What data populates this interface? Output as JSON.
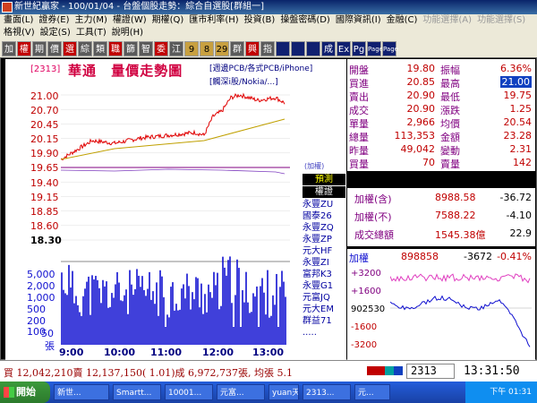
{
  "window": {
    "title": "新世紀贏家 - 100/01/04 - 台盤個股走勢：綜合自選股[群組一]"
  },
  "menu": {
    "row1": [
      "畫面(L)",
      "證券(E)",
      "主力(M)",
      "權證(W)",
      "期權(Q)",
      "匯市利率(H)",
      "投資(B)",
      "操盤密碼(D)",
      "國際資訊(I)",
      "金融(C)",
      "功能選擇(A)",
      "功能選擇(S)"
    ],
    "row2": [
      "格視(V)",
      "設定(S)",
      "工具(T)",
      "說明(H)"
    ]
  },
  "toolbar": {
    "buttons": [
      "加",
      "權",
      "期",
      "價",
      "選",
      "綜",
      "類",
      "職",
      "篩",
      "智",
      "委",
      "江",
      "9",
      "8",
      "29",
      "群",
      "興",
      "指",
      "",
      "",
      "",
      "成",
      "Ex",
      "Pg",
      "Page",
      "Page"
    ]
  },
  "stock": {
    "code": "[2313]",
    "name": "華通",
    "chart_title": "量價走勢圖",
    "concept_line1": "[週邊PCB/各式PCB/iPhone]",
    "concept_line2": "[觸深i股/Nokia/...]"
  },
  "price_axis_labels": [
    "21.00",
    "20.70",
    "20.45",
    "20.15",
    "19.90",
    "19.65",
    "19.40",
    "19.15",
    "18.85",
    "18.60",
    "18.30"
  ],
  "volume_axis_labels": [
    "5,000",
    "2,000",
    "1,000",
    "500",
    "200",
    "100",
    "50",
    "張"
  ],
  "time_labels": [
    "9:00",
    "10:00",
    "11:00",
    "12:00",
    "13:00"
  ],
  "plus_label": "(加權)",
  "side_list": {
    "header1": "預測",
    "header2": "權證",
    "items": [
      "永豐ZU",
      "國泰26",
      "永豐ZQ",
      "永豐ZP",
      "元大HF",
      "永豐ZI",
      "富邦K3",
      "永豐G1",
      "元富JQ",
      "元大EM",
      "群益71",
      "....."
    ]
  },
  "quote": {
    "rows": [
      {
        "l1": "開盤",
        "v1": "19.80",
        "l2": "振幅",
        "v2": "6.36%"
      },
      {
        "l1": "買進",
        "v1": "20.85",
        "l2": "最高",
        "v2": "21.00"
      },
      {
        "l1": "賣出",
        "v1": "20.90",
        "l2": "最低",
        "v2": "19.75"
      },
      {
        "l1": "成交",
        "v1": "20.90",
        "l2": "漲跌",
        "v2": "1.25"
      },
      {
        "l1": "單量",
        "v1": "2,966",
        "l2": "均價",
        "v2": "20.54"
      },
      {
        "l1": "總量",
        "v1": "113,353",
        "l2": "金額",
        "v2": "23.28"
      },
      {
        "l1": "昨量",
        "v1": "49,042",
        "l2": "變動",
        "v2": "2.31"
      },
      {
        "l1": "買量",
        "v1": "70",
        "l2": "賣量",
        "v2": "142"
      }
    ]
  },
  "index": {
    "rows": [
      {
        "l": "加權(含)",
        "v1": "8988.58",
        "v2": "-36.72"
      },
      {
        "l": "加權(不)",
        "v1": "7588.22",
        "v2": "-4.10"
      },
      {
        "l": "成交總額",
        "v1": "1545.38億",
        "v2": "22.9"
      }
    ]
  },
  "mini": {
    "header": "加權",
    "value": "898858",
    "change": "-3672",
    "pct": "-0.41%",
    "y_labels": [
      "+3200",
      "+1600",
      "902530",
      "-1600",
      "-3200"
    ]
  },
  "status": {
    "ticker": "買 12,042,210賣 12,137,150( 1.01)成 6,972,737張, 均張 5.1",
    "code": "2313",
    "time": "13:31:50"
  },
  "taskbar": {
    "start": "開始",
    "buttons": [
      "新世...",
      "Smartt...",
      "10001...",
      "元富...",
      "yuan天...",
      "2313...",
      "元..."
    ],
    "clock": "下午 01:31"
  },
  "chart_data": [
    {
      "type": "line",
      "title": "量價走勢圖",
      "x": [
        "9:00",
        "10:00",
        "11:00",
        "12:00",
        "13:00"
      ],
      "series": [
        {
          "values": [
            19.8,
            20.15,
            20.25,
            20.3,
            20.95
          ]
        }
      ],
      "ylim": [
        18.3,
        21.0
      ],
      "reference_price": 19.65
    },
    {
      "type": "bar",
      "x": [
        "9:00",
        "10:00",
        "11:00",
        "12:00",
        "13:00"
      ],
      "ylabel": "張",
      "scale": "log"
    }
  ],
  "colors": {
    "up": "#c00000",
    "down": "#1010d0",
    "accent_purple": "#800080"
  }
}
